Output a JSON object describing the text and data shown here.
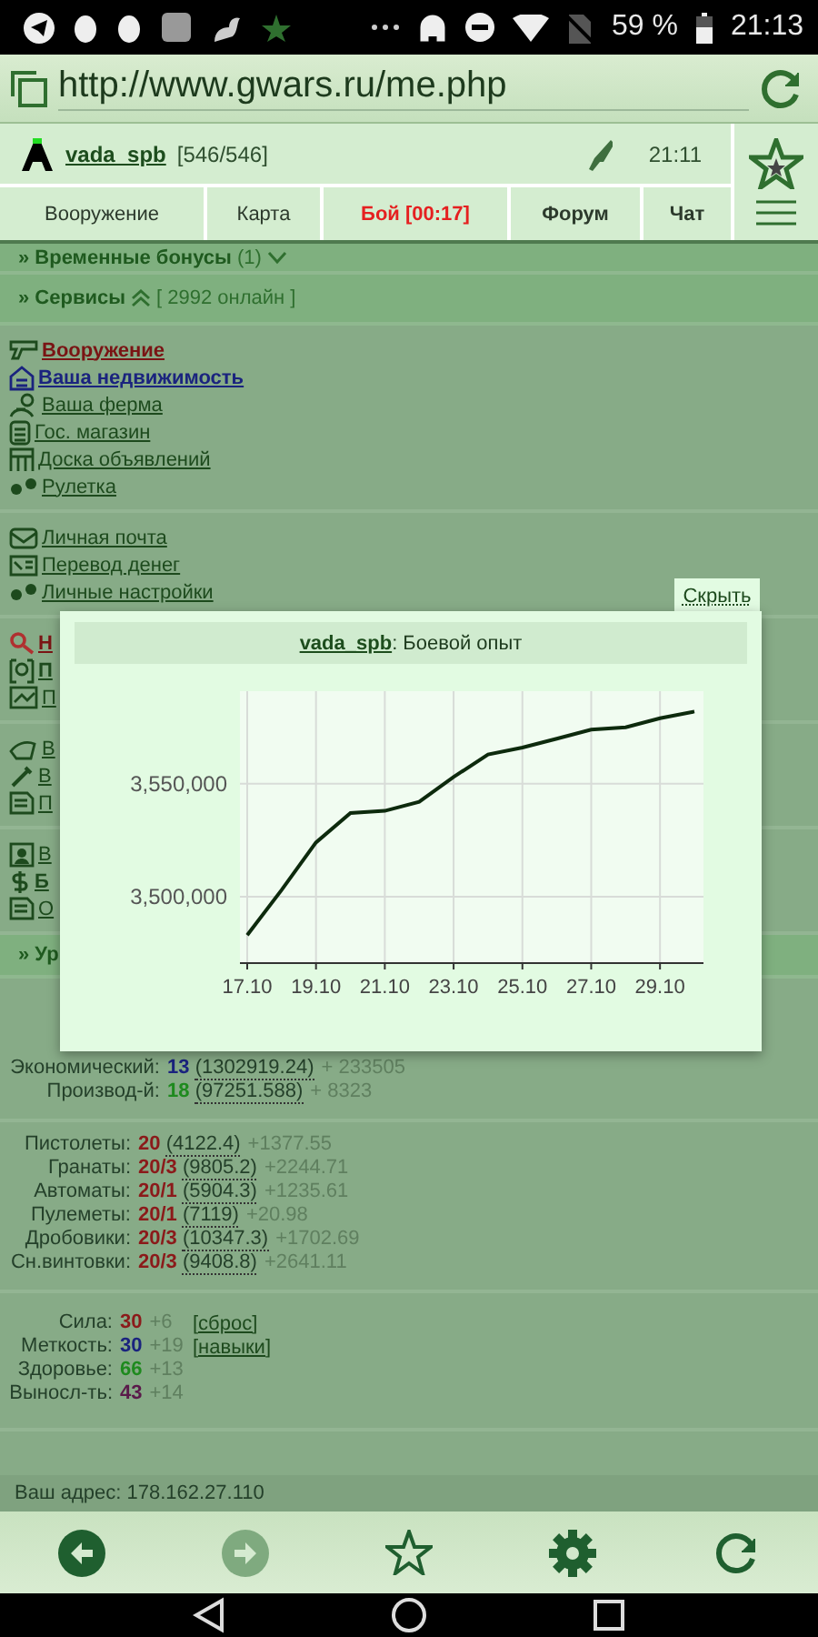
{
  "status_bar": {
    "battery": "59 %",
    "time": "21:13"
  },
  "browser": {
    "url": "http://www.gwars.ru/me.php"
  },
  "header": {
    "player": "vada_spb",
    "hp": "[546/546]",
    "time": "21:11"
  },
  "nav_tabs": [
    {
      "label": "Вооружение",
      "kind": "plain"
    },
    {
      "label": "Карта",
      "kind": "plain"
    },
    {
      "label": "Бой [00:17]",
      "kind": "alert"
    },
    {
      "label": "Форум",
      "kind": "bold"
    },
    {
      "label": "Чат",
      "kind": "bold"
    }
  ],
  "bonuses": {
    "title": "» Временные бонусы",
    "count": "(1)",
    "expanded": false
  },
  "services": {
    "title": "» Сервисы",
    "online": "[ 2992 онлайн ]",
    "expanded": true
  },
  "link_groups": [
    [
      {
        "label": "Вооружение",
        "kind": "alert"
      },
      {
        "label": "Ваша недвижимость",
        "kind": "blue"
      },
      {
        "label": "Ваша ферма",
        "kind": "plain"
      },
      {
        "label": "Гос. магазин",
        "kind": "plain"
      },
      {
        "label": "Доска объявлений",
        "kind": "plain"
      },
      {
        "label": "Рулетка",
        "kind": "plain"
      }
    ],
    [
      {
        "label": "Личная почта",
        "kind": "plain"
      },
      {
        "label": "Перевод денег",
        "kind": "plain"
      },
      {
        "label": "Личные настройки",
        "kind": "plain"
      }
    ],
    [
      {
        "label": "Н",
        "kind": "alert"
      },
      {
        "label": "П",
        "kind": "bold"
      },
      {
        "label": "П",
        "kind": "plain"
      }
    ],
    [
      {
        "label": "В",
        "kind": "plain"
      },
      {
        "label": "В",
        "kind": "plain"
      },
      {
        "label": "П",
        "kind": "plain"
      }
    ],
    [
      {
        "label": "В",
        "kind": "plain"
      },
      {
        "label": "Б",
        "kind": "bold"
      },
      {
        "label": "О",
        "kind": "plain"
      }
    ]
  ],
  "levels_section": {
    "title": "» Ур"
  },
  "popup": {
    "hide_label": "Скрыть",
    "player": "vada_spb",
    "title_suffix": ": Боевой опыт",
    "chart_data": {
      "type": "line",
      "categories": [
        "17.10",
        null,
        "19.10",
        null,
        "21.10",
        null,
        "23.10",
        null,
        "25.10",
        null,
        "27.10",
        null,
        "29.10",
        null
      ],
      "series": [
        {
          "color": "#0d2a0d",
          "values": [
            3483000,
            3503000,
            3524000,
            3537000,
            3538000,
            3542000,
            3553000,
            3563000,
            3566000,
            3570000,
            3574000,
            3575000,
            3579000,
            3582000
          ]
        }
      ],
      "grid": true,
      "ylim": [
        3471000,
        3591000
      ],
      "yticks": [
        {
          "value": 3500000,
          "label": "3,500,000"
        },
        {
          "value": 3550000,
          "label": "3,550,000"
        }
      ]
    }
  },
  "economy": [
    {
      "label": "Экономический:",
      "level": "13",
      "value": "(1302919.24)",
      "gain": "+ 233505",
      "color": "#1a237e"
    },
    {
      "label": "Производ-й:",
      "level": "18",
      "value": "(97251.588)",
      "gain": "+ 8323",
      "color": "#1e8a1e"
    }
  ],
  "weapons": [
    {
      "label": "Пистолеты:",
      "level": "20",
      "value": "(4122.4)",
      "gain": "+1377.55"
    },
    {
      "label": "Гранаты:",
      "level": "20/3",
      "value": "(9805.2)",
      "gain": "+2244.71"
    },
    {
      "label": "Автоматы:",
      "level": "20/1",
      "value": "(5904.3)",
      "gain": "+1235.61"
    },
    {
      "label": "Пулеметы:",
      "level": "20/1",
      "value": "(7119)",
      "gain": "+20.98"
    },
    {
      "label": "Дробовики:",
      "level": "20/3",
      "value": "(10347.3)",
      "gain": "+1702.69"
    },
    {
      "label": "Сн.винтовки:",
      "level": "20/3",
      "value": "(9408.8)",
      "gain": "+2641.11"
    }
  ],
  "stats": [
    {
      "label": "Сила:",
      "value": "30",
      "bonus": "+6",
      "color": "#8b1a1a",
      "action": "[сброс]"
    },
    {
      "label": "Меткость:",
      "value": "30",
      "bonus": "+19",
      "color": "#1a237e",
      "action": "[навыки]"
    },
    {
      "label": "Здоровье:",
      "value": "66",
      "bonus": "+13",
      "color": "#1e8a1e"
    },
    {
      "label": "Выносл-ть:",
      "value": "43",
      "bonus": "+14",
      "color": "#5a1a4a"
    }
  ],
  "address": "Ваш адрес: 178.162.27.110",
  "toolbar": [
    {
      "disabled": false
    },
    {
      "disabled": true
    },
    {
      "disabled": false
    },
    {
      "disabled": false
    },
    {
      "disabled": false
    }
  ]
}
